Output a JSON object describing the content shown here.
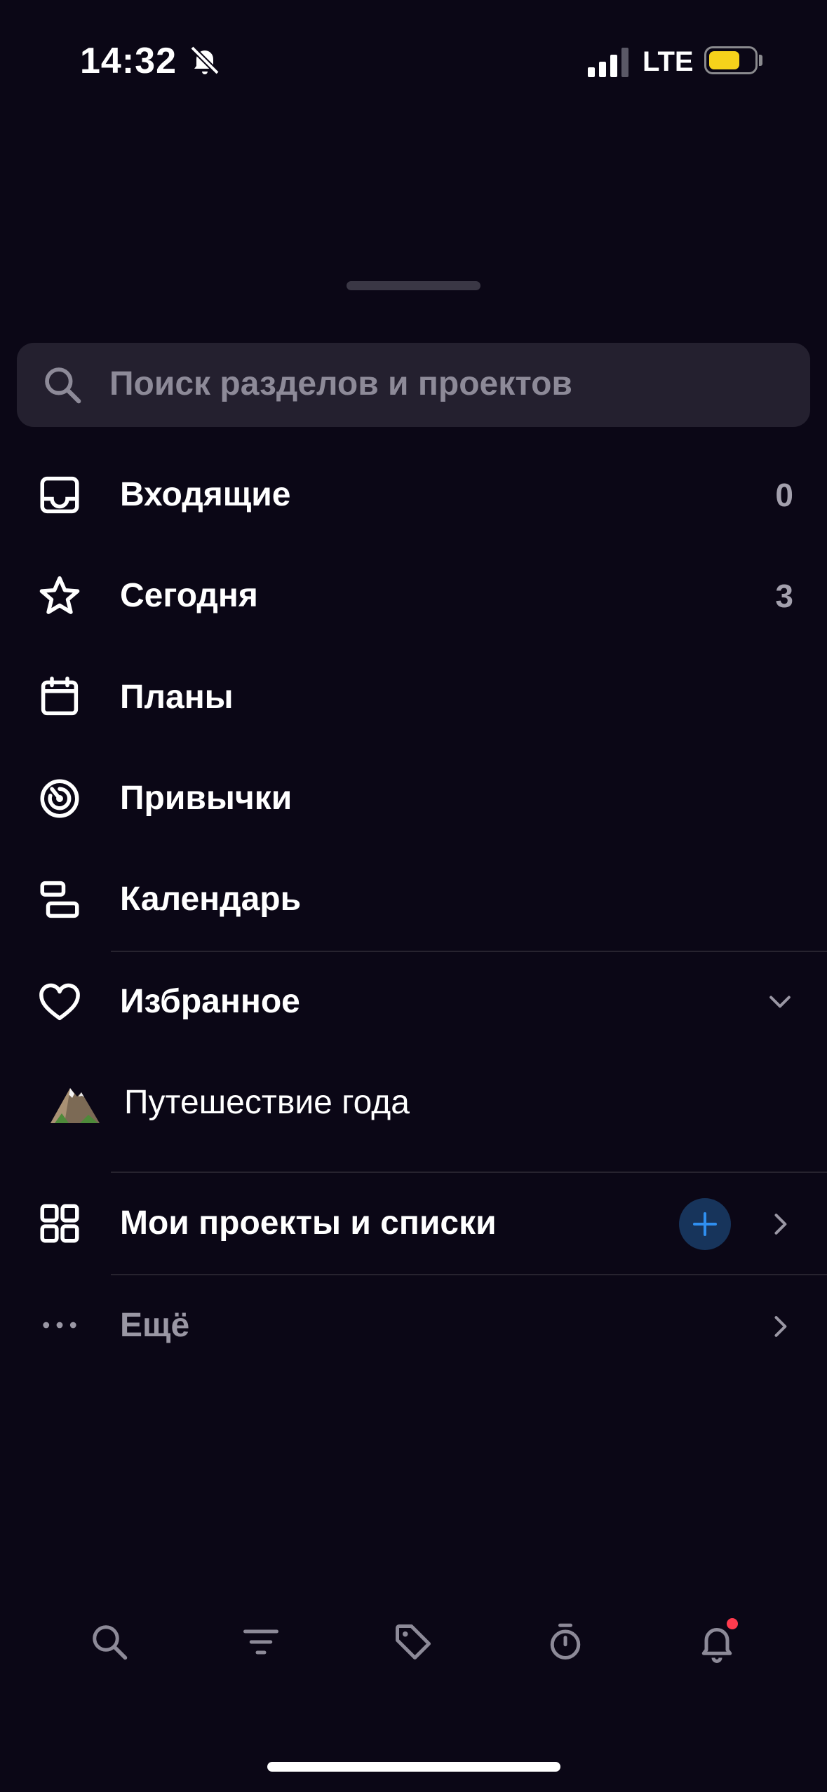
{
  "status_bar": {
    "time": "14:32",
    "network": "LTE",
    "battery_level": 0.7,
    "battery_color": "#f6d21b",
    "icons": [
      "bell-slash-icon",
      "cellular-signal-icon",
      "battery-icon"
    ]
  },
  "search": {
    "placeholder": "Поиск разделов и проектов",
    "icon": "search-icon"
  },
  "menu": {
    "inbox": {
      "label": "Входящие",
      "count": "0",
      "icon": "inbox-tray-icon"
    },
    "today": {
      "label": "Сегодня",
      "count": "3",
      "icon": "star-icon"
    },
    "plans": {
      "label": "Планы",
      "icon": "calendar-icon"
    },
    "habits": {
      "label": "Привычки",
      "icon": "habit-target-icon"
    },
    "calendar": {
      "label": "Календарь",
      "icon": "timeline-blocks-icon"
    }
  },
  "favorites": {
    "label": "Избранное",
    "icon": "heart-icon",
    "expanded": true,
    "items": [
      {
        "label": "Путешествие года",
        "icon": "mountain-emoji-icon"
      }
    ]
  },
  "projects": {
    "label": "Мои проекты и списки",
    "icon": "grid-icon",
    "add_icon": "plus-icon"
  },
  "more": {
    "label": "Ещё",
    "icon": "ellipsis-icon"
  },
  "toolbar": {
    "icons": [
      "search-icon",
      "filter-icon",
      "tag-icon",
      "stopwatch-icon",
      "bell-icon"
    ],
    "notification_dot_color": "#ff3b4e"
  },
  "colors": {
    "background": "#0b0716",
    "search_bg": "#24202f",
    "accent": "#2f8ff0",
    "add_button_bg": "#17345b"
  }
}
